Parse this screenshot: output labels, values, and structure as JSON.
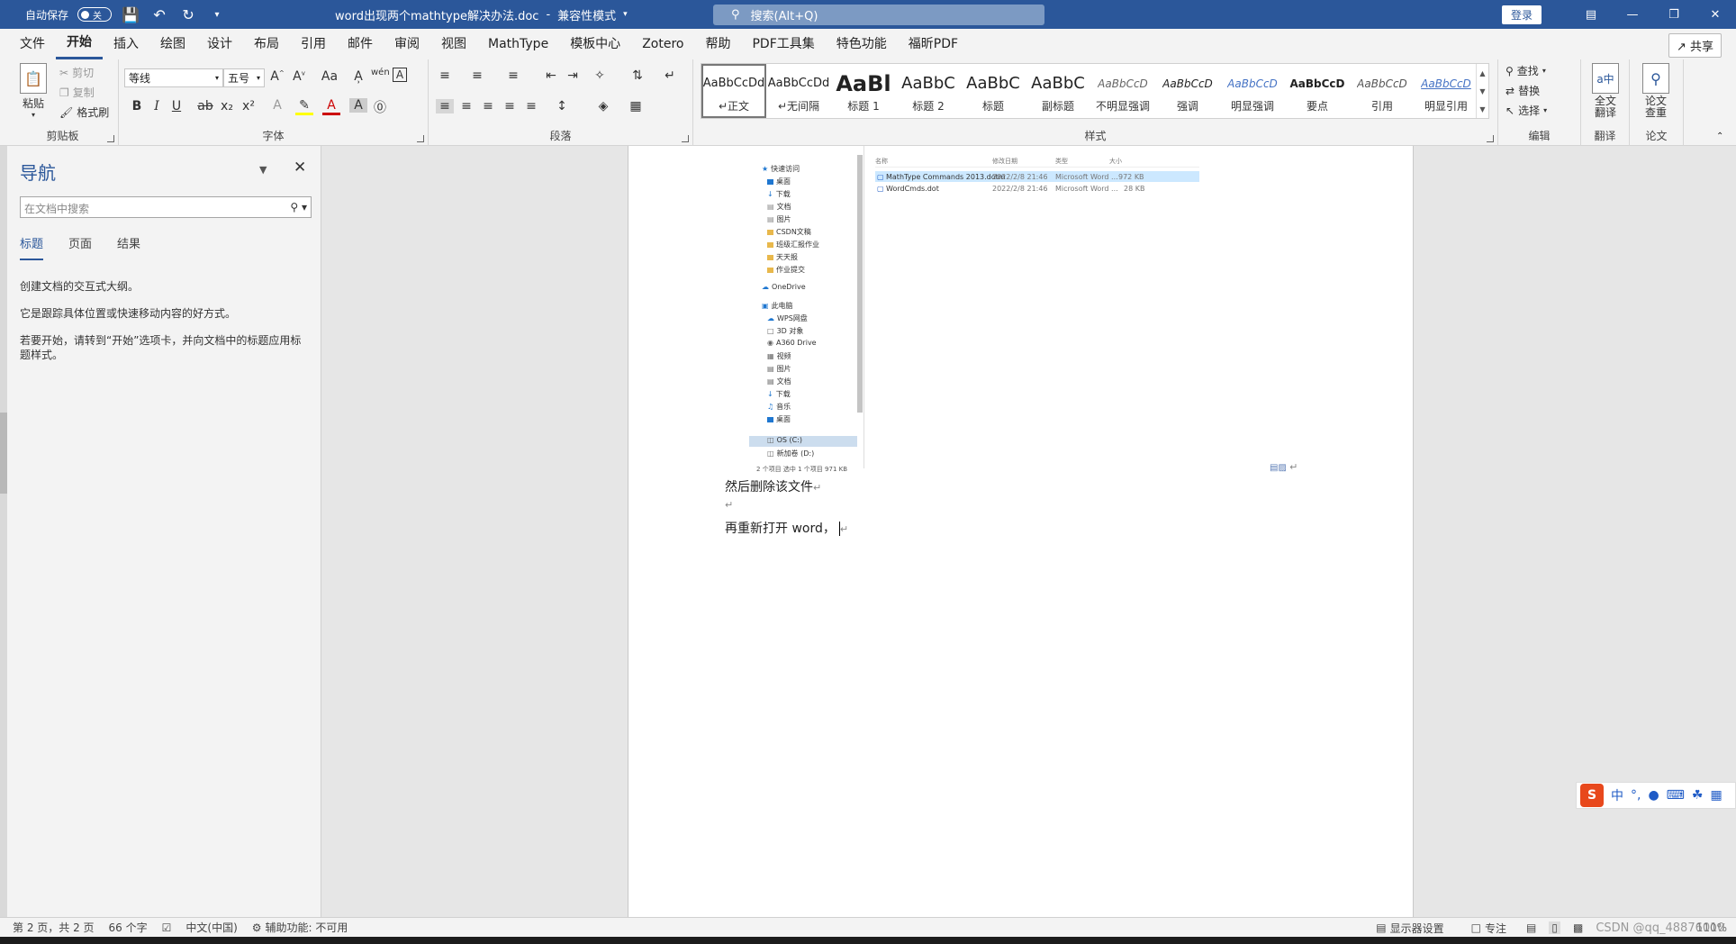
{
  "titlebar": {
    "autosave_label": "自动保存",
    "autosave_state": "关",
    "doc_title": "word出现两个mathtype解决办法.doc",
    "mode": "兼容性模式",
    "search_placeholder": "搜索(Alt+Q)",
    "login_label": "登录"
  },
  "menu": {
    "tabs": [
      "文件",
      "开始",
      "插入",
      "绘图",
      "设计",
      "布局",
      "引用",
      "邮件",
      "审阅",
      "视图",
      "MathType",
      "模板中心",
      "Zotero",
      "帮助",
      "PDF工具集",
      "特色功能",
      "福昕PDF"
    ],
    "share_label": "共享"
  },
  "ribbon": {
    "clipboard": {
      "label": "剪贴板",
      "paste": "粘贴",
      "cut": "剪切",
      "copy": "复制",
      "format_painter": "格式刷"
    },
    "font": {
      "label": "字体",
      "font_name": "等线",
      "font_size": "五号",
      "case": "Aa",
      "bold": "B",
      "italic": "I",
      "underline": "U",
      "strike": "ab",
      "sub": "x₂",
      "sup": "x²"
    },
    "paragraph": {
      "label": "段落"
    },
    "styles": {
      "label": "样式",
      "items": [
        {
          "sample": "AaBbCcDd",
          "name": "正文"
        },
        {
          "sample": "AaBbCcDd",
          "name": "无间隔"
        },
        {
          "sample": "AaBl",
          "name": "标题 1"
        },
        {
          "sample": "AaBbC",
          "name": "标题 2"
        },
        {
          "sample": "AaBbC",
          "name": "标题"
        },
        {
          "sample": "AaBbC",
          "name": "副标题"
        },
        {
          "sample": "AaBbCcD",
          "name": "不明显强调"
        },
        {
          "sample": "AaBbCcD",
          "name": "强调"
        },
        {
          "sample": "AaBbCcD",
          "name": "明显强调"
        },
        {
          "sample": "AaBbCcD",
          "name": "要点"
        },
        {
          "sample": "AaBbCcD",
          "name": "引用"
        },
        {
          "sample": "AaBbCcD",
          "name": "明显引用"
        }
      ]
    },
    "editing": {
      "label": "编辑",
      "find": "查找",
      "replace": "替换",
      "select": "选择"
    },
    "translate": {
      "label": "翻译",
      "full_translate": "全文翻译"
    },
    "paper": {
      "label": "论文",
      "check": "论文查重"
    }
  },
  "nav": {
    "title": "导航",
    "search_placeholder": "在文档中搜索",
    "tabs": [
      "标题",
      "页面",
      "结果"
    ],
    "line1": "创建文档的交互式大纲。",
    "line2": "它是跟踪具体位置或快速移动内容的好方式。",
    "line3": "若要开始，请转到“开始”选项卡，并向文档中的标题应用标题样式。"
  },
  "explorer": {
    "tree": [
      "快速访问",
      "桌面",
      "下载",
      "文档",
      "图片",
      "CSDN文稿",
      "班级汇报作业",
      "天天报",
      "作业提交",
      "OneDrive",
      "此电脑",
      "WPS网盘",
      "3D 对象",
      "A360 Drive",
      "视频",
      "图片",
      "文档",
      "下载",
      "音乐",
      "桌面",
      "OS (C:)",
      "新加卷 (D:)"
    ],
    "columns": [
      "名称",
      "修改日期",
      "类型",
      "大小"
    ],
    "files": [
      {
        "name": "MathType Commands 2013.dotm",
        "date": "2022/2/8 21:46",
        "type": "Microsoft Word ...",
        "size": "972 KB"
      },
      {
        "name": "WordCmds.dot",
        "date": "2022/2/8 21:46",
        "type": "Microsoft Word ...",
        "size": "28 KB"
      }
    ],
    "status": "2 个项目    选中 1 个项目  971 KB"
  },
  "document": {
    "line1": "然后删除该文件",
    "line2": "再重新打开 word，"
  },
  "statusbar": {
    "page": "第 2 页，共 2 页",
    "words": "66 个字",
    "language": "中文(中国)",
    "accessibility": "辅助功能: 不可用",
    "display_settings": "显示器设置",
    "focus": "专注",
    "zoom": "110%",
    "watermark": "CSDN @qq_48876010"
  },
  "ime": {
    "mode": "中"
  }
}
